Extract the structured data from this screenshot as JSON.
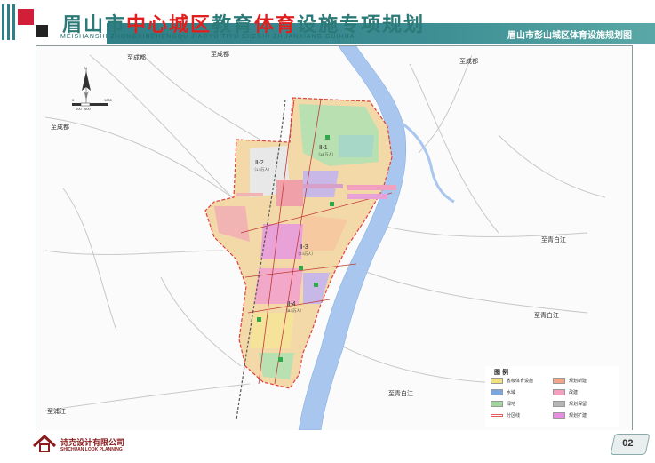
{
  "header": {
    "title_part1": "眉山市",
    "title_part2": "中心城区",
    "title_part3": "教育",
    "title_part4": "体育",
    "title_part5": "设施专项规划",
    "pinyin": "MEISHANSHI ZHONGXINCHENGQU JIAOYU TIYU SHESHI ZHUANXIANG GUIHUA",
    "subtitle": "眉山市彭山城区体育设施规划图"
  },
  "map": {
    "road_labels": {
      "north_west_1": "至成都",
      "north_west_2": "至成都",
      "north_east": "至成都",
      "west": "至成都",
      "east_1": "至青白江",
      "east_2": "至青白江",
      "south_east": "至青白江",
      "south_west": "至浦江"
    },
    "districts": [
      {
        "id": "d1",
        "name": "Ⅱ-1",
        "pop": "（14 万人）"
      },
      {
        "id": "d2",
        "name": "Ⅱ-2",
        "pop": "（1.5万人）"
      },
      {
        "id": "d3",
        "name": "Ⅱ-3",
        "pop": "（7.5万人）"
      },
      {
        "id": "d4",
        "name": "Ⅱ-4",
        "pop": "（8.5万人）"
      }
    ],
    "north_arrow": "N",
    "scale": {
      "zero": "0",
      "mid1": "200",
      "mid2": "500",
      "end": "1000"
    }
  },
  "legend": {
    "title": "图 例",
    "items": [
      {
        "label": "省级体育设施",
        "color": "#f1e27a"
      },
      {
        "label": "规划新建",
        "color": "#f3a58a"
      },
      {
        "label": "水域",
        "color": "#7aa7e0"
      },
      {
        "label": "改建",
        "color": "#f3a0c0"
      },
      {
        "label": "绿地",
        "color": "#9fd79a"
      },
      {
        "label": "规划保留",
        "color": "#b7b7b7"
      },
      {
        "label": "分区线",
        "color": "#e06060"
      },
      {
        "label": "规划扩建",
        "color": "#e88ee0"
      }
    ]
  },
  "footer": {
    "company": "诗克设计有限公司",
    "company_en": "SHICHUAN LOOK PLANNING",
    "page_number": "02"
  }
}
